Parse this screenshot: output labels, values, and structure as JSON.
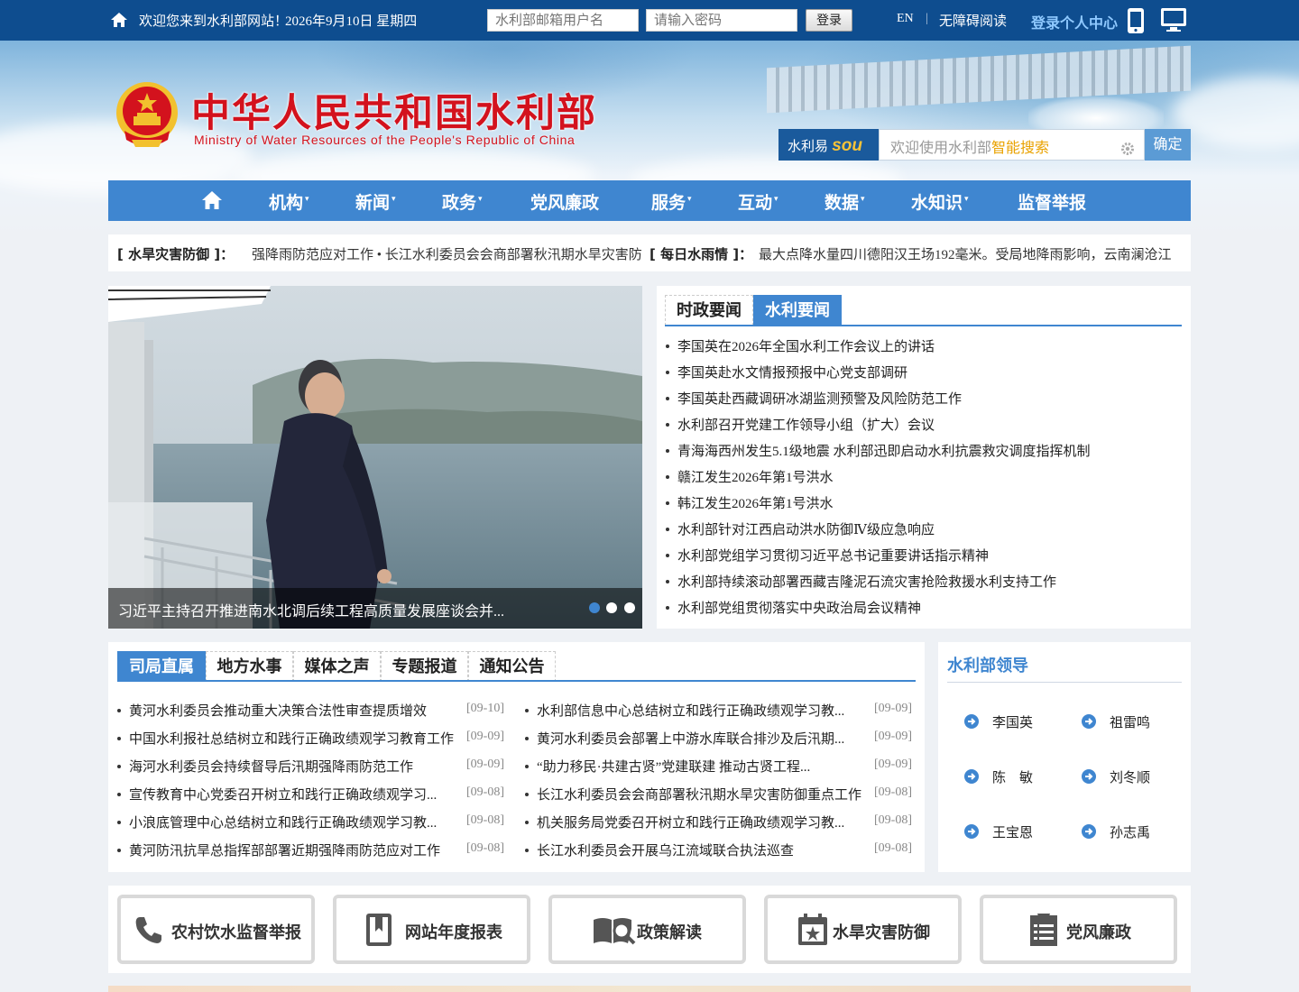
{
  "topbar": {
    "welcome": "欢迎您来到水利部网站！",
    "date": "2026年9月10日 星期四",
    "username_placeholder": "水利部邮箱用户名",
    "password_placeholder": "请输入密码",
    "login_label": "登录",
    "lang_label": "EN",
    "separator": "|",
    "accessible_label": "无障碍阅读",
    "personal_center_label": "登录个人中心"
  },
  "header": {
    "title": "中华人民共和国水利部",
    "subtitle": "Ministry of Water Resources of the People's Republic of China",
    "search_brand_prefix": "水利易",
    "search_brand_suffix": "sou",
    "search_placeholder_a": "欢迎使用水利部",
    "search_placeholder_b": "智能搜索",
    "search_button": "确定"
  },
  "nav": {
    "items": [
      {
        "label": "机构",
        "dropdown": true
      },
      {
        "label": "新闻",
        "dropdown": true
      },
      {
        "label": "政务",
        "dropdown": true
      },
      {
        "label": "党风廉政",
        "dropdown": false
      },
      {
        "label": "服务",
        "dropdown": true
      },
      {
        "label": "互动",
        "dropdown": true
      },
      {
        "label": "数据",
        "dropdown": true
      },
      {
        "label": "水知识",
        "dropdown": true
      },
      {
        "label": "监督举报",
        "dropdown": false
      }
    ],
    "caret": "▾"
  },
  "ticker": {
    "label1": "[ 水旱灾害防御 ]：",
    "text1": "强降雨防范应对工作 • 长江水利委员会会商部署秋汛期水旱灾害防御重点工作",
    "label2": "[ 每日水雨情 ]：",
    "text2": "最大点降水量四川德阳汉王场192毫米。受局地降雨影响，云南澜沧江"
  },
  "carousel": {
    "caption": "习近平主持召开推进南水北调后续工程高质量发展座谈会并...",
    "slide_count": 3,
    "active_index": 0
  },
  "news_panel": {
    "tabs": [
      "时政要闻",
      "水利要闻"
    ],
    "active_tab": 1,
    "items": [
      "李国英在2026年全国水利工作会议上的讲话",
      "李国英赴水文情报预报中心党支部调研",
      "李国英赴西藏调研冰湖监测预警及风险防范工作",
      "水利部召开党建工作领导小组（扩大）会议",
      "青海海西州发生5.1级地震 水利部迅即启动水利抗震救灾调度指挥机制",
      "赣江发生2026年第1号洪水",
      "韩江发生2026年第1号洪水",
      "水利部针对江西启动洪水防御Ⅳ级应急响应",
      "水利部党组学习贯彻习近平总书记重要讲话指示精神",
      "水利部持续滚动部署西藏吉隆泥石流灾害抢险救援水利支持工作",
      "水利部党组贯彻落实中央政治局会议精神"
    ]
  },
  "dept_panel": {
    "tabs": [
      "司局直属",
      "地方水事",
      "媒体之声",
      "专题报道",
      "通知公告"
    ],
    "active_tab": 0,
    "left": [
      {
        "title": "黄河水利委员会推动重大决策合法性审查提质增效",
        "date": "[09-10]"
      },
      {
        "title": "中国水利报社总结树立和践行正确政绩观学习教育工作",
        "date": "[09-09]"
      },
      {
        "title": "海河水利委员会持续督导后汛期强降雨防范工作",
        "date": "[09-09]"
      },
      {
        "title": "宣传教育中心党委召开树立和践行正确政绩观学习...",
        "date": "[09-08]"
      },
      {
        "title": "小浪底管理中心总结树立和践行正确政绩观学习教...",
        "date": "[09-08]"
      },
      {
        "title": "黄河防汛抗旱总指挥部部署近期强降雨防范应对工作",
        "date": "[09-08]"
      }
    ],
    "right": [
      {
        "title": "水利部信息中心总结树立和践行正确政绩观学习教...",
        "date": "[09-09]"
      },
      {
        "title": "黄河水利委员会部署上中游水库联合排沙及后汛期...",
        "date": "[09-09]"
      },
      {
        "title": "“助力移民·共建古贤”党建联建 推动古贤工程...",
        "date": "[09-09]"
      },
      {
        "title": "长江水利委员会会商部署秋汛期水旱灾害防御重点工作",
        "date": "[09-08]"
      },
      {
        "title": "机关服务局党委召开树立和践行正确政绩观学习教...",
        "date": "[09-08]"
      },
      {
        "title": "长江水利委员会开展乌江流域联合执法巡查",
        "date": "[09-08]"
      }
    ]
  },
  "leaders": {
    "title": "水利部领导",
    "names": [
      "李国英",
      "祖雷鸣",
      "陈　敏",
      "刘冬顺",
      "王宝恩",
      "孙志禹"
    ]
  },
  "quick_links": [
    {
      "label": "农村饮水监督举报",
      "icon": "phone-icon"
    },
    {
      "label": "网站年度报表",
      "icon": "bookmark-book-icon"
    },
    {
      "label": "政策解读",
      "icon": "book-search-icon"
    },
    {
      "label": "水旱灾害防御",
      "icon": "calendar-star-icon"
    },
    {
      "label": "党风廉政",
      "icon": "document-list-icon"
    }
  ],
  "colors": {
    "topbar": "#0e4d8f",
    "nav": "#3f86d0",
    "accent_red": "#d3121d",
    "search_highlight": "#e9a200"
  }
}
